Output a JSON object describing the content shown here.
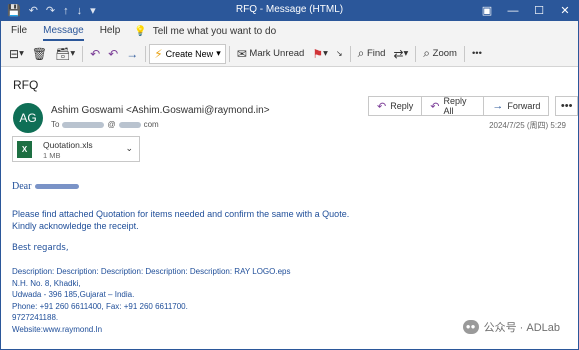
{
  "window": {
    "title": "RFQ  -  Message (HTML)"
  },
  "menu": {
    "tabs": [
      "File",
      "Message",
      "Help"
    ],
    "tell_me": "Tell me what you want to do"
  },
  "ribbon": {
    "create_new": "Create New",
    "mark_unread": "Mark Unread",
    "find": "Find",
    "zoom": "Zoom"
  },
  "message": {
    "subject": "RFQ",
    "avatar_initials": "AG",
    "sender": "Ashim Goswami <Ashim.Goswami@raymond.in>",
    "to_label": "To",
    "to_suffix": "@",
    "to_domain": "com",
    "date": "2024/7/25 (周四) 5:29",
    "reply": "Reply",
    "reply_all": "Reply All",
    "forward": "Forward"
  },
  "attachment": {
    "name": "Quotation.xls",
    "size": "1 MB",
    "icon_text": "X"
  },
  "body": {
    "greeting": "Dear",
    "line1": "Please find attached Quotation for items needed and confirm the same with a Quote.",
    "line2": "Kindly acknowledge the receipt.",
    "regards": "Best regards,",
    "sig1": "Description: Description: Description: Description: Description: RAY LOGO.eps",
    "sig2": "N.H. No. 8, Khadki,",
    "sig3": "Udwada - 396 185,Gujarat – India.",
    "sig4": "Phone: +91 260 6611400, Fax: +91 260 6611700.",
    "sig5": "9727241188.",
    "sig6": "Website:www.raymond.In"
  },
  "watermark": {
    "text": "公众号 · ADLab"
  },
  "colors": {
    "titlebar": "#2b579a",
    "avatar": "#0f6f56",
    "body_text": "#1f4e99",
    "excel": "#1d6f42"
  }
}
